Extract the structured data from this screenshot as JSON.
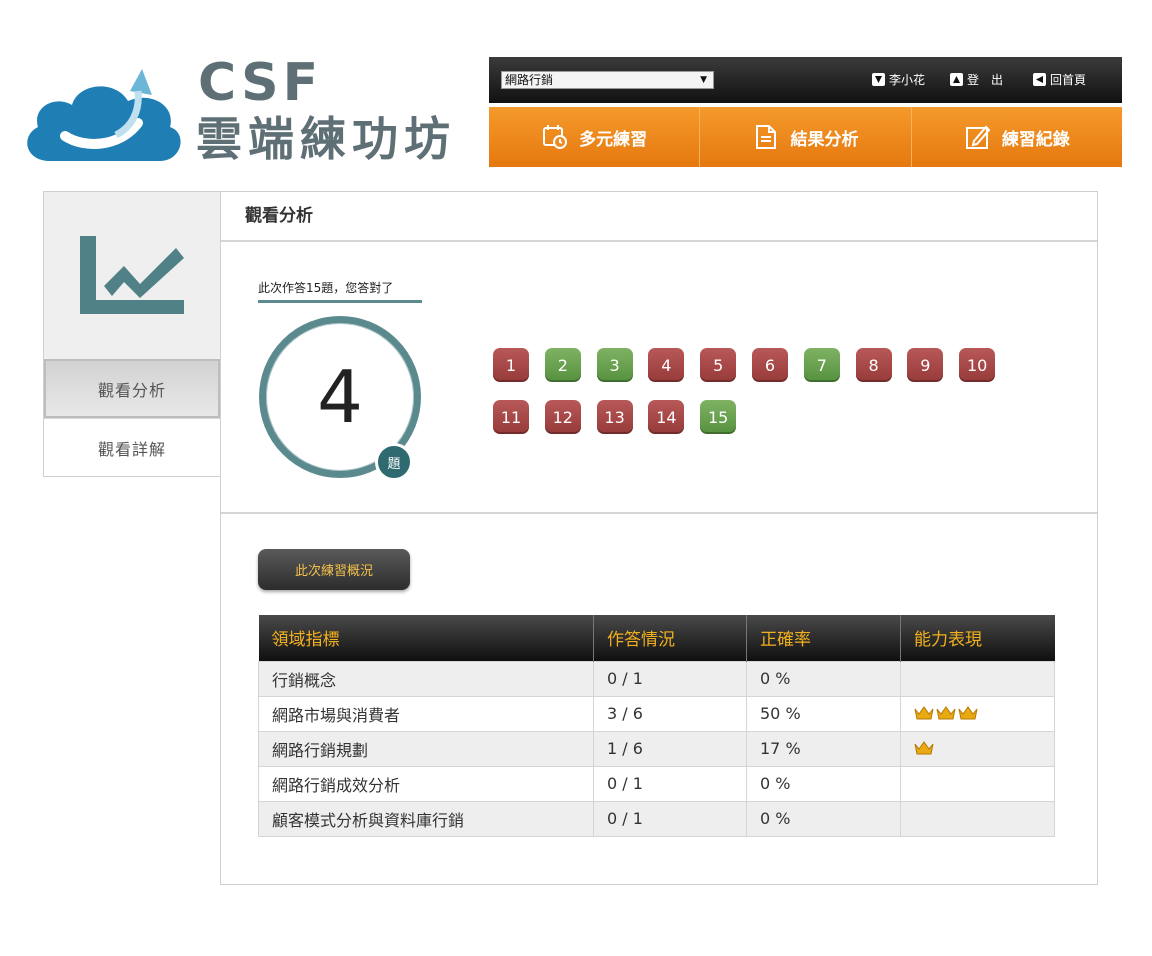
{
  "brand": {
    "name_en": "CSF",
    "name_cn": "雲端練功坊"
  },
  "topbar": {
    "course_select": "網路行銷",
    "user": "李小花",
    "logout": "登　出",
    "home": "回首頁"
  },
  "nav": [
    {
      "label": "多元練習",
      "icon": "calendar-clock-icon"
    },
    {
      "label": "結果分析",
      "icon": "document-icon"
    },
    {
      "label": "練習紀錄",
      "icon": "edit-pencil-icon"
    }
  ],
  "sidebar": {
    "hero_icon": "chart-trend-icon",
    "items": [
      {
        "label": "觀看分析",
        "active": true
      },
      {
        "label": "觀看詳解",
        "active": false
      }
    ]
  },
  "main": {
    "title": "觀看分析",
    "score_caption": "此次作答15題，您答對了",
    "score": "4",
    "score_unit": "題",
    "questions": [
      {
        "num": "1",
        "correct": false
      },
      {
        "num": "2",
        "correct": true
      },
      {
        "num": "3",
        "correct": true
      },
      {
        "num": "4",
        "correct": false
      },
      {
        "num": "5",
        "correct": false
      },
      {
        "num": "6",
        "correct": false
      },
      {
        "num": "7",
        "correct": true
      },
      {
        "num": "8",
        "correct": false
      },
      {
        "num": "9",
        "correct": false
      },
      {
        "num": "10",
        "correct": false
      },
      {
        "num": "11",
        "correct": false
      },
      {
        "num": "12",
        "correct": false
      },
      {
        "num": "13",
        "correct": false
      },
      {
        "num": "14",
        "correct": false
      },
      {
        "num": "15",
        "correct": true
      }
    ],
    "summary_button": "此次練習概況",
    "table": {
      "headers": [
        "領域指標",
        "作答情況",
        "正確率",
        "能力表現"
      ],
      "rows": [
        {
          "domain": "行銷概念",
          "answered": "0 / 1",
          "rate": "0 %",
          "crowns": 0
        },
        {
          "domain": "網路市場與消費者",
          "answered": "3 / 6",
          "rate": "50 %",
          "crowns": 3
        },
        {
          "domain": "網路行銷規劃",
          "answered": "1 / 6",
          "rate": "17 %",
          "crowns": 1
        },
        {
          "domain": "網路行銷成效分析",
          "answered": "0 / 1",
          "rate": "0 %",
          "crowns": 0
        },
        {
          "domain": "顧客模式分析與資料庫行銷",
          "answered": "0 / 1",
          "rate": "0 %",
          "crowns": 0
        }
      ]
    }
  },
  "colors": {
    "accent": "#e5780f",
    "teal": "#5b8a8e",
    "wrong": "#a94545",
    "right": "#6aa34f",
    "gold": "#f2b01e"
  }
}
